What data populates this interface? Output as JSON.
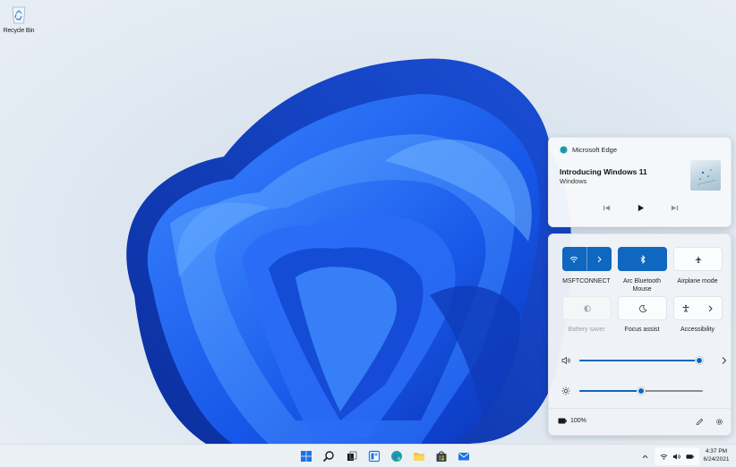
{
  "desktop": {
    "recycle_bin_label": "Recycle Bin"
  },
  "media_flyout": {
    "app_name": "Microsoft Edge",
    "track_title": "Introducing Windows 11",
    "track_artist": "Windows",
    "controls": [
      "previous-icon",
      "play-icon",
      "next-icon"
    ]
  },
  "quick_settings": {
    "tiles": [
      {
        "label": "MSFTCONNECT",
        "icon": "wifi-icon",
        "state": "on"
      },
      {
        "label": "Arc Bluetooth Mouse",
        "icon": "bluetooth-icon",
        "state": "on"
      },
      {
        "label": "Airplane mode",
        "icon": "airplane-icon",
        "state": "off"
      },
      {
        "label": "Battery saver",
        "icon": "battery-saver-icon",
        "state": "disabled"
      },
      {
        "label": "Focus assist",
        "icon": "moon-icon",
        "state": "off"
      },
      {
        "label": "Accessibility",
        "icon": "accessibility-icon",
        "state": "off"
      }
    ],
    "volume_level": 1.0,
    "brightness_level": 0.5,
    "battery": "100%",
    "accent_color": "#0f67bf"
  },
  "taskbar": {
    "apps": [
      "windows-start-icon",
      "search-icon",
      "task-view-icon",
      "widgets-icon",
      "edge-icon",
      "file-explorer-icon",
      "store-icon",
      "mail-icon"
    ],
    "tray_icons": [
      "chevron-up-icon",
      "wifi-icon",
      "volume-icon",
      "battery-icon"
    ],
    "time": "4:37 PM",
    "date": "6/24/2021"
  }
}
